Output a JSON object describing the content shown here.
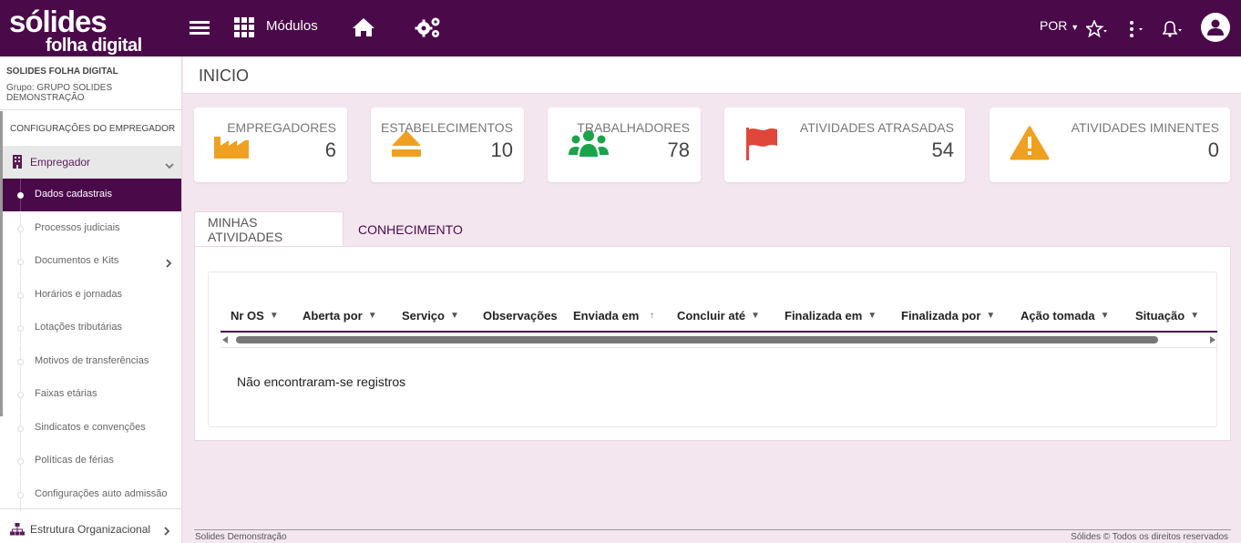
{
  "topbar": {
    "logo_line1": "sólides",
    "logo_line2": "folha digital",
    "modules_label": "Módulos",
    "language": "POR",
    "colors": {
      "bg": "#4a0a4a",
      "fg": "#ffffff"
    }
  },
  "sidebar": {
    "company": "SOLIDES FOLHA DIGITAL",
    "group": "Grupo: GRUPO SOLIDES DEMONSTRAÇÃO",
    "section": "CONFIGURAÇÕES DO EMPREGADOR",
    "employer_label": "Empregador",
    "items": [
      {
        "label": "Dados cadastrais"
      },
      {
        "label": "Processos judiciais"
      },
      {
        "label": "Documentos e Kits"
      },
      {
        "label": "Horários e jornadas"
      },
      {
        "label": "Lotações tributárias"
      },
      {
        "label": "Motivos de transferências"
      },
      {
        "label": "Faixas etárias"
      },
      {
        "label": "Sindicatos e convenções"
      },
      {
        "label": "Políticas de férias"
      },
      {
        "label": "Configurações auto admissão"
      }
    ],
    "structure_label": "Estrutura Organizacional"
  },
  "page": {
    "title": "INICIO"
  },
  "cards": [
    {
      "label": "EMPREGADORES",
      "value": "6",
      "icon": "factory-icon",
      "color": "#f0a020"
    },
    {
      "label": "ESTABELECIMENTOS",
      "value": "10",
      "icon": "eject-icon",
      "color": "#f0a020"
    },
    {
      "label": "TRABALHADORES",
      "value": "78",
      "icon": "users-icon",
      "color": "#1aa34a"
    },
    {
      "label": "ATIVIDADES ATRASADAS",
      "value": "54",
      "icon": "flag-icon",
      "color": "#e0473a"
    },
    {
      "label": "ATIVIDADES IMINENTES",
      "value": "0",
      "icon": "warning-icon",
      "color": "#f0a020"
    }
  ],
  "tabs": [
    {
      "label": "MINHAS ATIVIDADES"
    },
    {
      "label": "CONHECIMENTO"
    }
  ],
  "grid": {
    "columns": [
      {
        "label": "Nr OS"
      },
      {
        "label": "Aberta por"
      },
      {
        "label": "Serviço"
      },
      {
        "label": "Observações"
      },
      {
        "label": "Enviada em"
      },
      {
        "label": "Concluir até"
      },
      {
        "label": "Finalizada em"
      },
      {
        "label": "Finalizada por"
      },
      {
        "label": "Ação tomada"
      },
      {
        "label": "Situação"
      }
    ],
    "empty_text": "Não encontraram-se registros"
  },
  "footer": {
    "left": "Solides Demonstração",
    "right": "Sólides © Todos os direitos reservados"
  }
}
